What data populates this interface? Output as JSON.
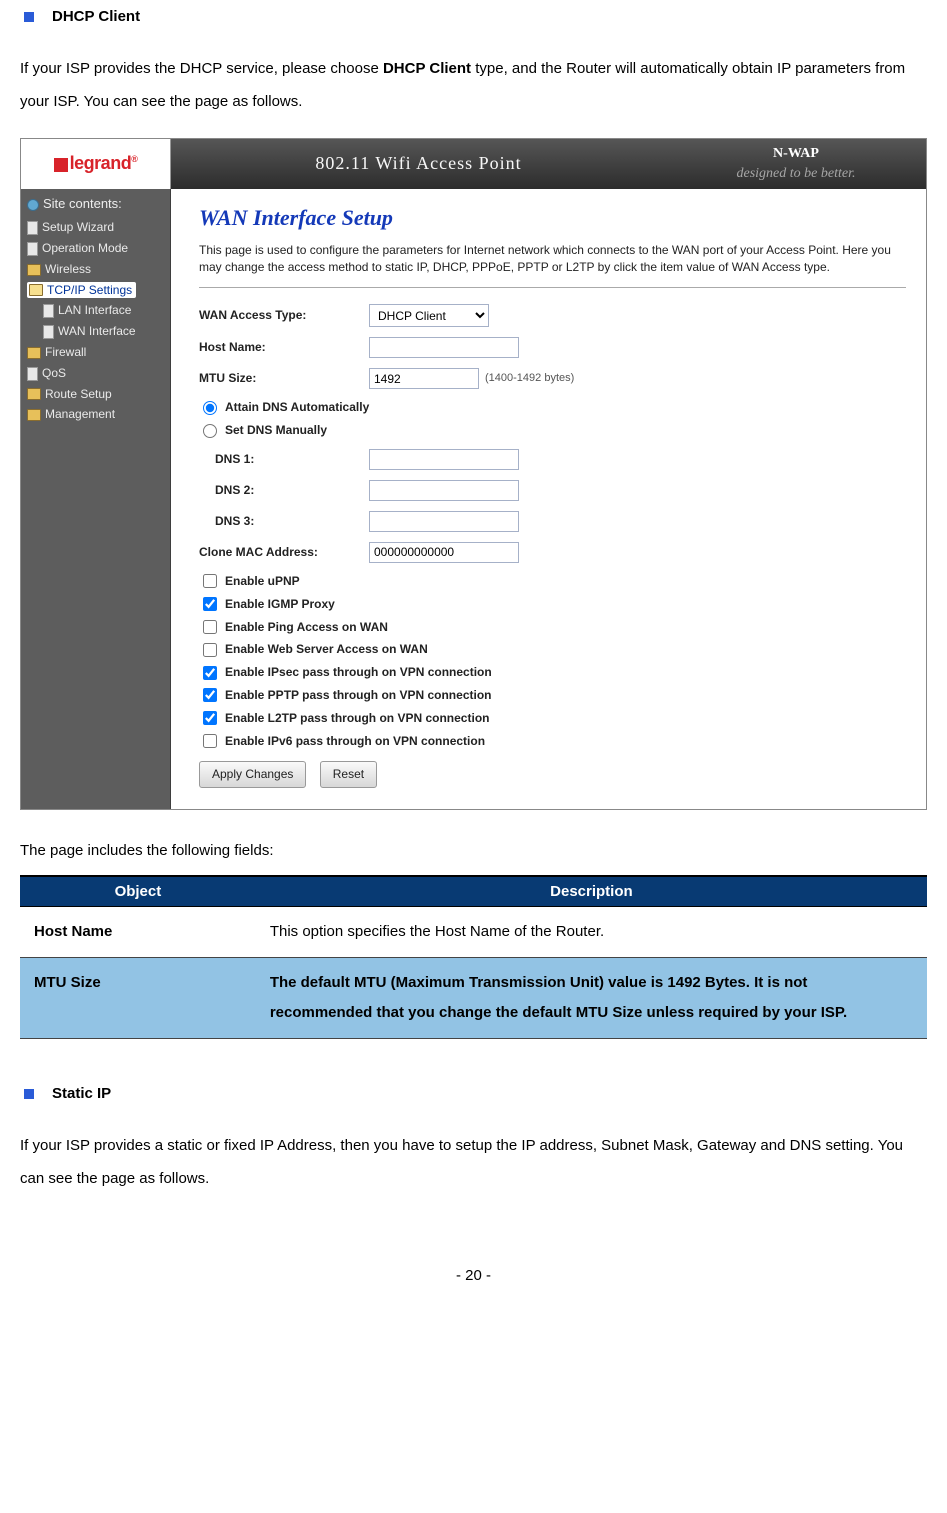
{
  "section1": {
    "title": "DHCP Client",
    "paragraph_pre": "If your ISP provides the DHCP service, please choose ",
    "paragraph_bold": "DHCP Client",
    "paragraph_post": " type, and the Router will automatically obtain IP parameters from your ISP. You can see the page as follows."
  },
  "router": {
    "logo_text": "legrand",
    "top_center": "802.11 Wifi Access Point",
    "top_right_brand": "N-WAP",
    "top_right_tag": "designed to be better.",
    "side_heading": "Site contents:",
    "nav": {
      "setup_wizard": "Setup Wizard",
      "operation_mode": "Operation Mode",
      "wireless": "Wireless",
      "tcpip": "TCP/IP Settings",
      "lan": "LAN Interface",
      "wan": "WAN Interface",
      "firewall": "Firewall",
      "qos": "QoS",
      "route_setup": "Route Setup",
      "management": "Management"
    },
    "page": {
      "title": "WAN Interface Setup",
      "desc": "This page is used to configure the parameters for Internet network which connects to the WAN port of your Access Point. Here you may change the access method to static IP, DHCP, PPPoE, PPTP or L2TP by click the item value of WAN Access type.",
      "labels": {
        "wan_access": "WAN Access Type:",
        "host_name": "Host Name:",
        "mtu_size": "MTU Size:",
        "dns1": "DNS 1:",
        "dns2": "DNS 2:",
        "dns3": "DNS 3:",
        "clone_mac": "Clone MAC Address:"
      },
      "values": {
        "wan_access_sel": "DHCP Client",
        "host_name": "",
        "mtu_size": "1492",
        "mtu_hint": "(1400-1492 bytes)",
        "dns1": "",
        "dns2": "",
        "dns3": "",
        "clone_mac": "000000000000"
      },
      "radios": {
        "attain": "Attain DNS Automatically",
        "manual": "Set DNS Manually"
      },
      "checks": {
        "upnp": "Enable uPNP",
        "igmp": "Enable IGMP Proxy",
        "ping": "Enable Ping Access on WAN",
        "web": "Enable Web Server Access on WAN",
        "ipsec": "Enable IPsec pass through on VPN connection",
        "pptp": "Enable PPTP pass through on VPN connection",
        "l2tp": "Enable L2TP pass through on VPN connection",
        "ipv6": "Enable IPv6 pass through on VPN connection"
      },
      "buttons": {
        "apply": "Apply Changes",
        "reset": "Reset"
      }
    }
  },
  "fields_intro": "The page includes the following fields:",
  "table": {
    "head_object": "Object",
    "head_desc": "Description",
    "rows": [
      {
        "obj": "Host Name",
        "desc": "This option specifies the Host Name of the Router.",
        "style": "plain"
      },
      {
        "obj": "MTU Size",
        "desc": "The default MTU (Maximum Transmission Unit) value is 1492 Bytes. It is not recommended that you change the default MTU Size unless required by your ISP.",
        "style": "blue"
      }
    ]
  },
  "section2": {
    "title": "Static IP",
    "para": "If your ISP provides a static or fixed IP Address, then you have to setup the IP address, Subnet Mask, Gateway and DNS setting. You can see the page as follows."
  },
  "page_number": "- 20 -"
}
